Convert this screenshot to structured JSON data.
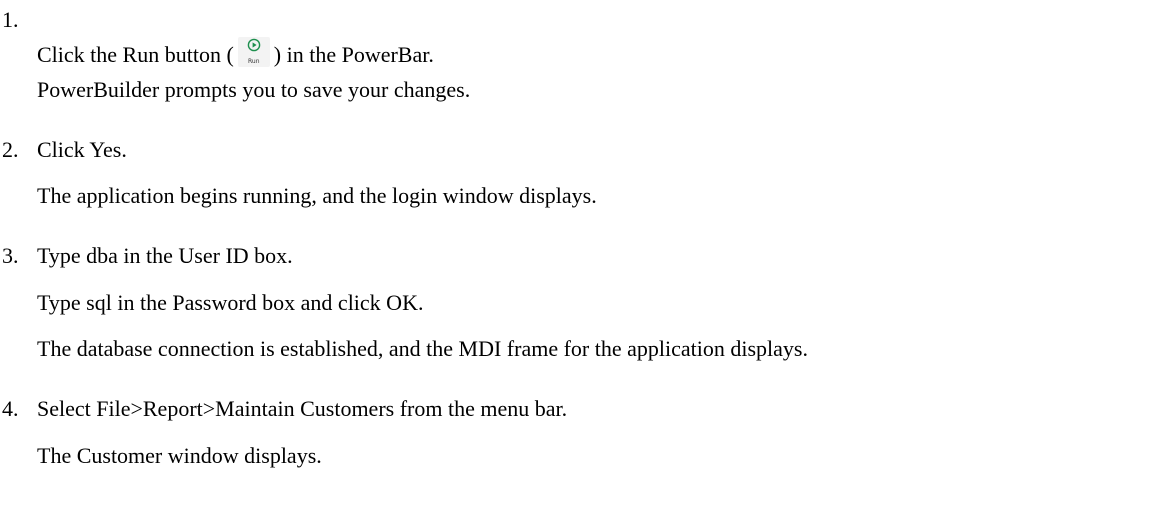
{
  "steps": [
    {
      "number": "1.",
      "instruction_before": "Click the Run button (",
      "button_caption": "Run",
      "button_icon": "run-play-icon",
      "instruction_after": ") in the PowerBar.",
      "notes": [
        "PowerBuilder prompts you to save your changes."
      ]
    },
    {
      "number": "2.",
      "instruction": "Click Yes.",
      "notes": [
        "The application begins running, and the login window displays."
      ]
    },
    {
      "number": "3.",
      "instruction": "Type dba in the User ID box.",
      "notes": [
        "Type sql in the Password box and click OK.",
        "The database connection is established, and the MDI frame for the application displays."
      ]
    },
    {
      "number": "4.",
      "instruction": "Select File>Report>Maintain Customers from the menu bar.",
      "notes": [
        "The Customer window displays."
      ]
    }
  ],
  "colors": {
    "text": "#000000",
    "run_icon": "#1e8f4e",
    "button_bg": "#f3f3f3"
  }
}
